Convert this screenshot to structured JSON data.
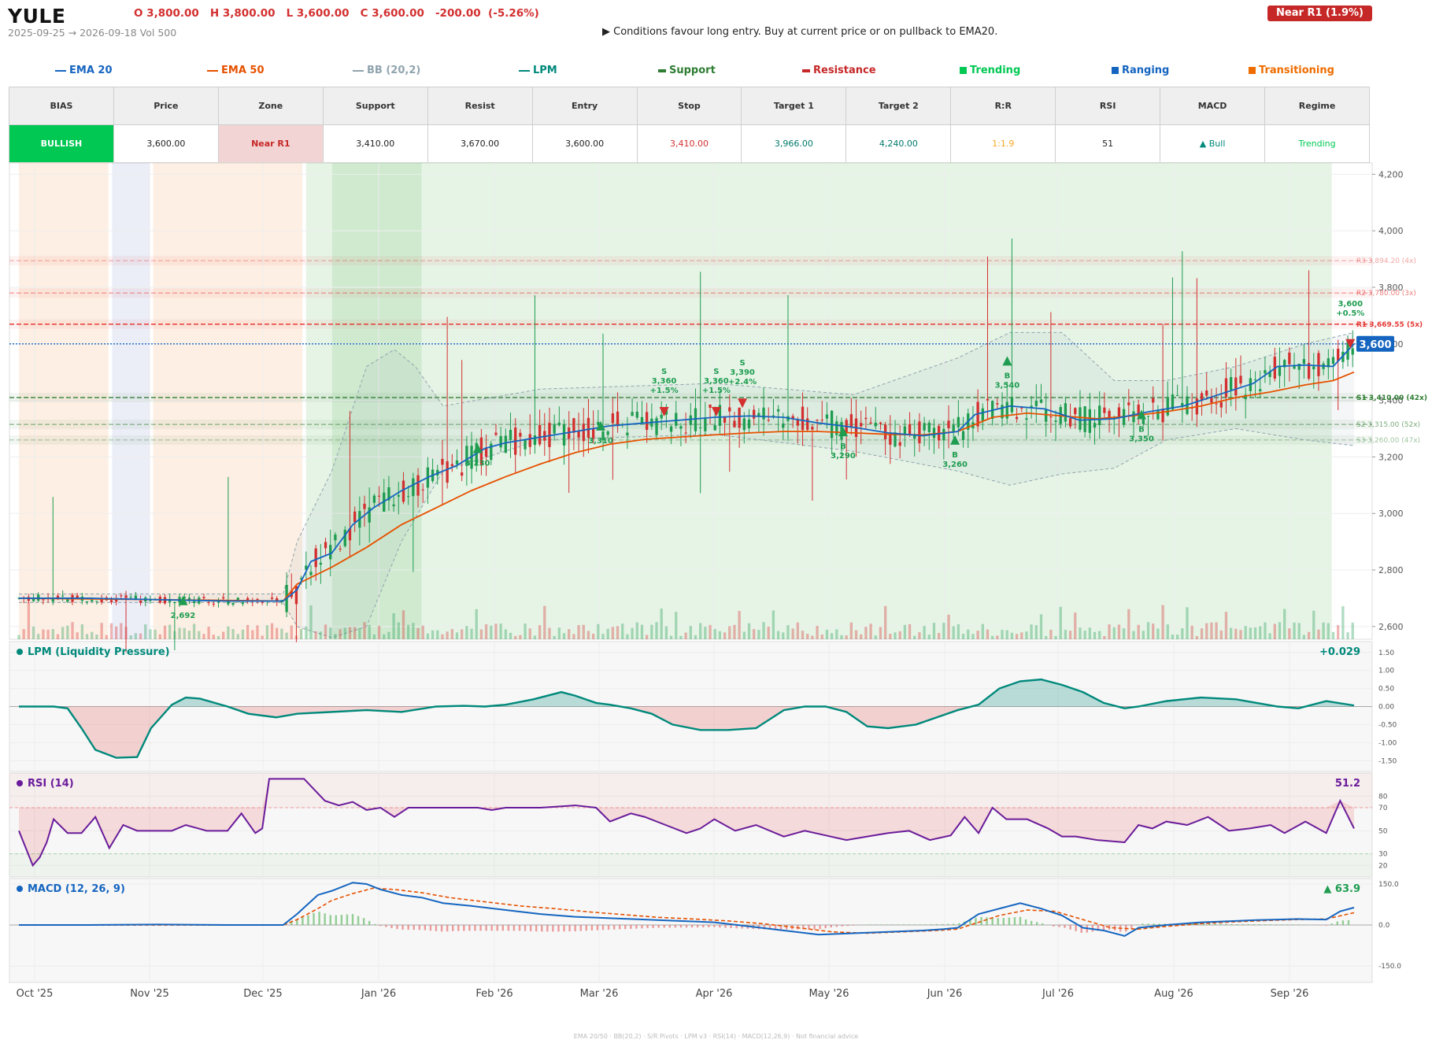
{
  "header": {
    "ticker": "YULE",
    "ohlc": "O 3,800.00   H 3,800.00   L 3,600.00   C 3,600.00   -200.00  (-5.26%)",
    "date_range": "2025-09-25 → 2026-09-18   Vol 500",
    "advice": "▶  Conditions favour long entry. Buy at current price or on pullback to EMA20.",
    "near_badge": "Near R1  (1.9%)"
  },
  "legend": [
    {
      "label": "EMA 20",
      "color": "#1565c0",
      "kind": "line"
    },
    {
      "label": "EMA 50",
      "color": "#e65100",
      "kind": "line"
    },
    {
      "label": "BB (20,2)",
      "color": "#90a4ae",
      "kind": "line"
    },
    {
      "label": "LPM",
      "color": "#00897b",
      "kind": "line"
    },
    {
      "label": "Support",
      "color": "#2e7d32",
      "kind": "dash"
    },
    {
      "label": "Resistance",
      "color": "#c62828",
      "kind": "dash"
    },
    {
      "label": "Trending",
      "color": "#00c853",
      "kind": "box"
    },
    {
      "label": "Ranging",
      "color": "#1565c0",
      "kind": "box"
    },
    {
      "label": "Transitioning",
      "color": "#ef6c00",
      "kind": "box"
    }
  ],
  "summary": {
    "headers": [
      "BIAS",
      "Price",
      "Zone",
      "Support",
      "Resist",
      "Entry",
      "Stop",
      "Target 1",
      "Target 2",
      "R:R",
      "RSI",
      "MACD",
      "Regime"
    ],
    "values": [
      "BULLISH",
      "3,600.00",
      "Near R1",
      "3,410.00",
      "3,670.00",
      "3,600.00",
      "3,410.00",
      "3,966.00",
      "4,240.00",
      "1:1.9",
      "51",
      "▲ Bull",
      "Trending"
    ],
    "colors": {
      "bias_bg": "#00c853",
      "zone_bg": "#f2d4d4",
      "zone_text": "#c62828",
      "stop": "#d32f2f",
      "target": "#00796b",
      "rr": "#f9a825",
      "macd": "#00897b",
      "regime": "#00c853"
    }
  },
  "chart_data": [
    {
      "type": "candlestick",
      "title": "",
      "x_axis_labels": [
        "Oct '25",
        "Nov '25",
        "Dec '25",
        "Jan '26",
        "Feb '26",
        "Mar '26",
        "Apr '26",
        "May '26",
        "Jun '26",
        "Jul '26",
        "Aug '26",
        "Sep '26"
      ],
      "y_ticks": [
        2600,
        2800,
        3000,
        3200,
        3400,
        3600,
        3800,
        4000,
        4200
      ],
      "y_tick_labels": [
        "2,600",
        "2,800",
        "3,000",
        "3,200",
        "3,400",
        "3,600",
        "3,800",
        "4,000",
        "4,200"
      ],
      "ylim": [
        2555,
        4240
      ],
      "last_price": 3600,
      "last_price_label": "3,600",
      "levels": [
        {
          "name": "R3",
          "label": "R3 3,894.20 (4x)",
          "value": 3894.2,
          "kind": "resistance"
        },
        {
          "name": "R2",
          "label": "R2 3,780.00 (3x)",
          "value": 3780,
          "kind": "resistance"
        },
        {
          "name": "R1",
          "label": "R1 3,669.55 (5x)",
          "value": 3669.55,
          "kind": "resistance"
        },
        {
          "name": "S1",
          "label": "S1 3,410.00 (42x)",
          "value": 3410,
          "kind": "support"
        },
        {
          "name": "S2",
          "label": "S2 3,315.00 (52x)",
          "value": 3315,
          "kind": "support"
        },
        {
          "name": "S3",
          "label": "S3 3,260.00 (47x)",
          "value": 3260,
          "kind": "support"
        }
      ],
      "regimes": [
        {
          "from": "2025-09-25",
          "to": "2025-10-19",
          "regime": "Transitioning"
        },
        {
          "from": "2025-10-20",
          "to": "2025-10-30",
          "regime": "Ranging"
        },
        {
          "from": "2025-10-31",
          "to": "2025-12-10",
          "regime": "Transitioning"
        },
        {
          "from": "2025-12-11",
          "to": "2026-01-11",
          "regime": "Trending"
        },
        {
          "from": "2025-12-18",
          "to": "2026-09-12",
          "regime": "Trending"
        }
      ],
      "signals": [
        {
          "date": "2025-11-08",
          "side": "B",
          "price": 2692,
          "text": "2,692"
        },
        {
          "date": "2026-01-26",
          "side": "B",
          "price": 3230,
          "text": "3,230"
        },
        {
          "date": "2026-02-28",
          "side": "B",
          "price": 3310,
          "text": "3,310"
        },
        {
          "date": "2026-03-17",
          "side": "S",
          "price": 3360,
          "text": "S|3,360|+1.5%"
        },
        {
          "date": "2026-03-31",
          "side": "S",
          "price": 3360,
          "text": "S|3,360|+1.5%"
        },
        {
          "date": "2026-04-07",
          "side": "S",
          "price": 3390,
          "text": "S|3,390|+2.4%"
        },
        {
          "date": "2026-05-04",
          "side": "B",
          "price": 3290,
          "text": "B|3,290"
        },
        {
          "date": "2026-06-03",
          "side": "B",
          "price": 3260,
          "text": "B|3,260"
        },
        {
          "date": "2026-06-17",
          "side": "B",
          "price": 3540,
          "text": "B|3,540"
        },
        {
          "date": "2026-07-23",
          "side": "B",
          "price": 3350,
          "text": "B|3,350"
        },
        {
          "date": "2026-09-17",
          "side": "S",
          "price": 3600,
          "text": "3,600|+0.5%"
        }
      ],
      "ema20": [
        [
          0,
          2700
        ],
        [
          20,
          2700
        ],
        [
          40,
          2695
        ],
        [
          60,
          2690
        ],
        [
          76,
          2690
        ],
        [
          80,
          2730
        ],
        [
          84,
          2830
        ],
        [
          90,
          2860
        ],
        [
          96,
          2960
        ],
        [
          102,
          3020
        ],
        [
          110,
          3080
        ],
        [
          118,
          3130
        ],
        [
          126,
          3170
        ],
        [
          134,
          3230
        ],
        [
          140,
          3250
        ],
        [
          150,
          3270
        ],
        [
          160,
          3290
        ],
        [
          170,
          3310
        ],
        [
          180,
          3320
        ],
        [
          190,
          3330
        ],
        [
          200,
          3340
        ],
        [
          210,
          3345
        ],
        [
          220,
          3340
        ],
        [
          230,
          3320
        ],
        [
          240,
          3305
        ],
        [
          250,
          3285
        ],
        [
          260,
          3275
        ],
        [
          270,
          3290
        ],
        [
          275,
          3350
        ],
        [
          285,
          3380
        ],
        [
          295,
          3370
        ],
        [
          305,
          3330
        ],
        [
          315,
          3335
        ],
        [
          325,
          3360
        ],
        [
          335,
          3380
        ],
        [
          345,
          3420
        ],
        [
          355,
          3460
        ],
        [
          362,
          3520
        ],
        [
          370,
          3525
        ],
        [
          378,
          3520
        ],
        [
          384,
          3600
        ]
      ],
      "ema50": [
        [
          0,
          2700
        ],
        [
          40,
          2695
        ],
        [
          76,
          2690
        ],
        [
          80,
          2750
        ],
        [
          90,
          2810
        ],
        [
          100,
          2880
        ],
        [
          110,
          2960
        ],
        [
          120,
          3020
        ],
        [
          130,
          3080
        ],
        [
          140,
          3130
        ],
        [
          150,
          3175
        ],
        [
          160,
          3215
        ],
        [
          170,
          3245
        ],
        [
          180,
          3262
        ],
        [
          190,
          3270
        ],
        [
          200,
          3278
        ],
        [
          210,
          3285
        ],
        [
          220,
          3290
        ],
        [
          230,
          3290
        ],
        [
          240,
          3285
        ],
        [
          250,
          3280
        ],
        [
          260,
          3278
        ],
        [
          270,
          3290
        ],
        [
          280,
          3340
        ],
        [
          290,
          3355
        ],
        [
          300,
          3345
        ],
        [
          310,
          3335
        ],
        [
          320,
          3345
        ],
        [
          330,
          3360
        ],
        [
          340,
          3380
        ],
        [
          350,
          3410
        ],
        [
          360,
          3430
        ],
        [
          370,
          3455
        ],
        [
          378,
          3470
        ],
        [
          384,
          3500
        ]
      ],
      "bb_upper": [
        [
          0,
          2715
        ],
        [
          76,
          2715
        ],
        [
          80,
          2900
        ],
        [
          90,
          3150
        ],
        [
          100,
          3520
        ],
        [
          108,
          3580
        ],
        [
          114,
          3520
        ],
        [
          122,
          3380
        ],
        [
          150,
          3440
        ],
        [
          200,
          3460
        ],
        [
          240,
          3420
        ],
        [
          270,
          3550
        ],
        [
          285,
          3640
        ],
        [
          300,
          3640
        ],
        [
          315,
          3470
        ],
        [
          330,
          3470
        ],
        [
          350,
          3520
        ],
        [
          370,
          3600
        ],
        [
          384,
          3640
        ]
      ],
      "bb_lower": [
        [
          0,
          2685
        ],
        [
          76,
          2685
        ],
        [
          80,
          2600
        ],
        [
          90,
          2560
        ],
        [
          100,
          2600
        ],
        [
          110,
          2900
        ],
        [
          122,
          3150
        ],
        [
          150,
          3260
        ],
        [
          200,
          3280
        ],
        [
          240,
          3220
        ],
        [
          270,
          3150
        ],
        [
          285,
          3100
        ],
        [
          300,
          3140
        ],
        [
          315,
          3160
        ],
        [
          330,
          3260
        ],
        [
          350,
          3300
        ],
        [
          370,
          3260
        ],
        [
          384,
          3240
        ]
      ],
      "volume_note": "Vol 500"
    },
    {
      "type": "line",
      "title": "LPM (Liquidity Pressure)",
      "last_value": "+0.029",
      "y_ticks": [
        1.5,
        1.0,
        0.5,
        0.0,
        -0.5,
        -1.0,
        -1.5
      ],
      "y_tick_labels": [
        "1.50",
        "1.00",
        "0.50",
        "0.00",
        "-0.50",
        "-1.00",
        "-1.50"
      ],
      "ylim": [
        -1.8,
        1.8
      ],
      "x": [
        0,
        10,
        14,
        18,
        22,
        28,
        34,
        38,
        44,
        48,
        52,
        60,
        66,
        74,
        80,
        90,
        100,
        110,
        120,
        128,
        134,
        140,
        148,
        156,
        160,
        166,
        170,
        176,
        182,
        188,
        196,
        204,
        212,
        220,
        226,
        232,
        238,
        244,
        250,
        258,
        264,
        270,
        276,
        282,
        288,
        294,
        300,
        306,
        312,
        318,
        322,
        330,
        340,
        350,
        356,
        362,
        368,
        376,
        384
      ],
      "y": [
        0,
        0,
        -0.05,
        -0.6,
        -1.2,
        -1.42,
        -1.4,
        -0.6,
        0.05,
        0.25,
        0.22,
        0,
        -0.2,
        -0.3,
        -0.2,
        -0.15,
        -0.1,
        -0.15,
        0,
        0.02,
        0,
        0.05,
        0.2,
        0.4,
        0.3,
        0.1,
        0.05,
        -0.05,
        -0.2,
        -0.5,
        -0.65,
        -0.65,
        -0.6,
        -0.1,
        0,
        0,
        -0.15,
        -0.55,
        -0.6,
        -0.5,
        -0.3,
        -0.1,
        0.05,
        0.5,
        0.7,
        0.75,
        0.6,
        0.4,
        0.1,
        -0.05,
        0,
        0.15,
        0.25,
        0.2,
        0.1,
        0,
        -0.05,
        0.15,
        0.03
      ]
    },
    {
      "type": "line",
      "title": "RSI (14)",
      "last_value": "51.2",
      "y_ticks": [
        80,
        70,
        50,
        30,
        20
      ],
      "y_tick_labels": [
        "80",
        "70",
        "50",
        "30",
        "20"
      ],
      "ylim": [
        10,
        100
      ],
      "overbought": 70,
      "oversold": 30,
      "x": [
        0,
        4,
        6,
        8,
        10,
        14,
        18,
        22,
        26,
        30,
        34,
        40,
        44,
        48,
        54,
        60,
        64,
        68,
        70,
        72,
        76,
        82,
        88,
        92,
        96,
        100,
        104,
        108,
        112,
        116,
        120,
        124,
        128,
        132,
        136,
        140,
        150,
        160,
        166,
        170,
        176,
        180,
        186,
        192,
        196,
        200,
        206,
        212,
        220,
        226,
        232,
        238,
        244,
        250,
        256,
        262,
        268,
        272,
        276,
        280,
        284,
        290,
        296,
        300,
        304,
        310,
        318,
        322,
        326,
        330,
        336,
        342,
        348,
        354,
        360,
        364,
        370,
        376,
        380,
        384
      ],
      "y": [
        50,
        20,
        27,
        40,
        60,
        48,
        48,
        62,
        35,
        55,
        50,
        50,
        50,
        55,
        50,
        50,
        65,
        48,
        52,
        95,
        95,
        95,
        76,
        72,
        75,
        68,
        70,
        62,
        70,
        70,
        70,
        70,
        70,
        70,
        68,
        70,
        70,
        72,
        70,
        58,
        65,
        62,
        55,
        48,
        52,
        60,
        50,
        55,
        45,
        50,
        46,
        42,
        45,
        48,
        50,
        42,
        46,
        62,
        48,
        70,
        60,
        60,
        52,
        45,
        45,
        42,
        40,
        55,
        52,
        58,
        55,
        62,
        50,
        52,
        55,
        48,
        58,
        48,
        76,
        52
      ]
    },
    {
      "type": "line",
      "title": "MACD (12, 26, 9)",
      "last_value": "▲ 63.9",
      "y_ticks": [
        150,
        0,
        -150
      ],
      "y_tick_labels": [
        "150.0",
        "0.0",
        "-150.0"
      ],
      "ylim": [
        -210,
        170
      ],
      "series": [
        {
          "name": "MACD",
          "color": "#1565c0",
          "x": [
            0,
            20,
            40,
            60,
            76,
            80,
            86,
            90,
            96,
            100,
            104,
            110,
            116,
            122,
            130,
            140,
            150,
            160,
            170,
            180,
            190,
            200,
            210,
            220,
            230,
            240,
            250,
            260,
            266,
            270,
            276,
            282,
            288,
            294,
            300,
            306,
            312,
            318,
            322,
            330,
            340,
            350,
            356,
            362,
            368,
            376,
            380,
            384
          ],
          "y": [
            0,
            0,
            2,
            0,
            0,
            40,
            110,
            125,
            155,
            150,
            130,
            110,
            100,
            80,
            70,
            55,
            40,
            30,
            25,
            20,
            15,
            10,
            -5,
            -20,
            -35,
            -30,
            -25,
            -20,
            -15,
            -10,
            40,
            60,
            80,
            60,
            35,
            -10,
            -20,
            -40,
            -10,
            0,
            10,
            15,
            18,
            20,
            22,
            20,
            50,
            63.9
          ]
        },
        {
          "name": "Signal",
          "color": "#e65100",
          "x": [
            0,
            40,
            76,
            80,
            86,
            90,
            96,
            102,
            108,
            116,
            124,
            134,
            144,
            154,
            164,
            174,
            184,
            194,
            204,
            214,
            224,
            234,
            244,
            254,
            264,
            270,
            276,
            282,
            290,
            298,
            306,
            314,
            322,
            330,
            340,
            350,
            360,
            368,
            376,
            384
          ],
          "y": [
            0,
            0,
            0,
            20,
            60,
            90,
            115,
            135,
            130,
            118,
            100,
            85,
            70,
            60,
            48,
            38,
            28,
            22,
            15,
            5,
            -10,
            -25,
            -30,
            -25,
            -20,
            -15,
            10,
            35,
            55,
            50,
            20,
            -10,
            -15,
            -5,
            5,
            12,
            17,
            20,
            22,
            45
          ]
        }
      ]
    }
  ],
  "footer": "EMA 20/50  ·  BB(20,2)  ·  S/R Pivots  ·  LPM v3  ·  RSI(14)  ·  MACD(12,26,9)  ·  Not financial advice"
}
